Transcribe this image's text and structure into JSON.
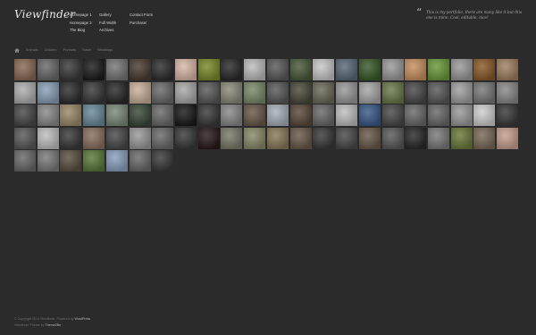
{
  "site": {
    "logo": "Viewfinder"
  },
  "nav": {
    "col1": [
      "Homepage 1",
      "Homepage 2",
      "The Blog"
    ],
    "col2": [
      "Gallery",
      "Full Width",
      "Archives"
    ],
    "col3": [
      "Contact Form",
      "Purchase!"
    ]
  },
  "tagline": "This is my portfolio, there are many like it but this one is mine. Cool, editable, nice!",
  "filters": {
    "home_icon": "home-icon",
    "items": [
      "Animals",
      "Children",
      "Portraits",
      "Travel",
      "Weddings"
    ]
  },
  "gallery": {
    "tiles": [
      "#8a6a55",
      "#6a6a6a",
      "#3a3a3a",
      "#1c1c1c",
      "#777777",
      "#4a3d33",
      "#2e2e2e",
      "#d8b9a8",
      "#7a8a2a",
      "#2a2a2a",
      "#bdbdbd",
      "#5a5a5a",
      "#4a5a3a",
      "#c8c8c8",
      "#5a6a7a",
      "#3a5a2a",
      "#9a9a9a",
      "#c89060",
      "#6a9a3a",
      "#9a9a9a",
      "#8a5a2a",
      "#a08060",
      "#b0b0b0",
      "#8aa0b8",
      "#2e2e2e",
      "#3a3a3a",
      "#2a2a2a",
      "#c9b19a",
      "#6a6a6a",
      "#aaaaaa",
      "#5a5a5a",
      "#8a8a7a",
      "#7a8a6a",
      "#5a5a5a",
      "#4a4a3a",
      "#6a6a5a",
      "#9a9a9a",
      "#a8a8a8",
      "#6a7a4a",
      "#4a4a4a",
      "#5a5a5a",
      "#a0a0a0",
      "#7a7a7a",
      "#8a8a8a",
      "#4a4a4a",
      "#8a8a8a",
      "#9a8a6a",
      "#6a8a9a",
      "#7a8a7a",
      "#3a4a3a",
      "#6a6a6a",
      "#1a1a1a",
      "#3a3a3a",
      "#8a8a8a",
      "#6a5a4a",
      "#a8b0b8",
      "#5a4a3a",
      "#6a6a6a",
      "#c0c0c0",
      "#3a5a8a",
      "#4a4a4a",
      "#6a6a6a",
      "#6a6a6a",
      "#9a9a9a",
      "#d0d0d0",
      "#3a3a3a",
      "#5a5a5a",
      "#c0c0c0",
      "#3a3a3a",
      "#8a7060",
      "#4a4a4a",
      "#9a9a9a",
      "#6a6a6a",
      "#3a3a3a",
      "#2a1a1a",
      "#7a7a6a",
      "#8a8a6a",
      "#8a7a5a",
      "#6a5a4a",
      "#3a3a3a",
      "#4a4a4a",
      "#6a5a4a",
      "#5a5a5a",
      "#2a2a2a",
      "#7a7a7a",
      "#6a7a3a",
      "#7a6a5a",
      "#c8a090",
      "#6a6a6a",
      "#7a7a7a",
      "#5a5040",
      "#5a7a3a",
      "#8aa0c0",
      "#6a6a6a",
      "#3a3a3a"
    ]
  },
  "footer": {
    "line1_prefix": "© Copyright 2014 Viewfinder. Powered by",
    "line1_link": "WordPress",
    "line2_prefix": "Viewfinder Theme by",
    "line2_link": "Theme2Be"
  }
}
